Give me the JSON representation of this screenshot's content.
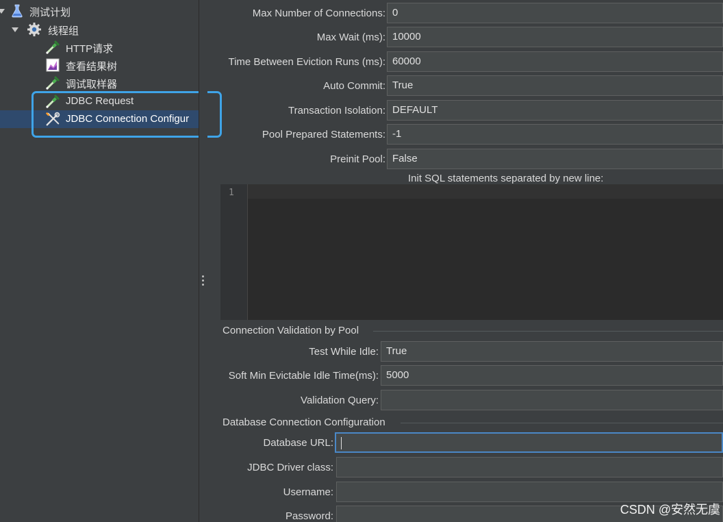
{
  "tree": {
    "items": [
      {
        "label": "测试计划",
        "icon": "flask-icon"
      },
      {
        "label": "线程组",
        "icon": "gear-icon"
      },
      {
        "label": "HTTP请求",
        "icon": "pipette-icon"
      },
      {
        "label": "查看结果树",
        "icon": "chart-icon"
      },
      {
        "label": "调试取样器",
        "icon": "pipette-icon"
      },
      {
        "label": "JDBC Request",
        "icon": "pipette-icon"
      },
      {
        "label": "JDBC Connection Configur",
        "icon": "wrench-screwdriver-icon"
      }
    ],
    "selected_index": 6
  },
  "pool": {
    "max_connections_label": "Max Number of Connections:",
    "max_connections_value": "0",
    "max_wait_label": "Max Wait (ms):",
    "max_wait_value": "10000",
    "eviction_label": "Time Between Eviction Runs (ms):",
    "eviction_value": "60000",
    "auto_commit_label": "Auto Commit:",
    "auto_commit_value": "True",
    "isolation_label": "Transaction Isolation:",
    "isolation_value": "DEFAULT",
    "prepared_label": "Pool Prepared Statements:",
    "prepared_value": "-1",
    "preinit_label": "Preinit Pool:",
    "preinit_value": "False"
  },
  "init_sql": {
    "caption": "Init SQL statements separated by new line:",
    "line_number": "1"
  },
  "validation": {
    "title": "Connection Validation by Pool",
    "test_idle_label": "Test While Idle:",
    "test_idle_value": "True",
    "soft_min_label": "Soft Min Evictable Idle Time(ms):",
    "soft_min_value": "5000",
    "query_label": "Validation Query:",
    "query_value": ""
  },
  "database": {
    "title": "Database Connection Configuration",
    "url_label": "Database URL:",
    "url_value": "",
    "driver_label": "JDBC Driver class:",
    "driver_value": "",
    "username_label": "Username:",
    "username_value": "",
    "password_label": "Password:",
    "password_value": ""
  },
  "watermark": "CSDN @安然无虞",
  "colors": {
    "accent": "#3fa4e8",
    "selection": "#2f4a6d",
    "background": "#3c3f41"
  }
}
